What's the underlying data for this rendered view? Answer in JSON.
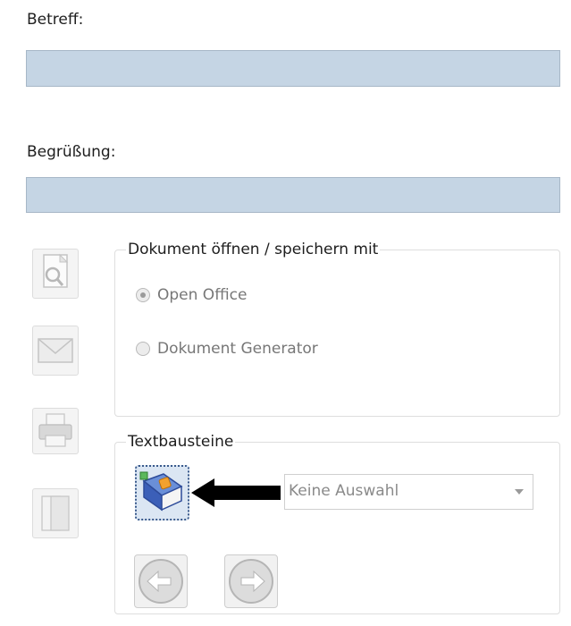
{
  "betreff": {
    "label": "Betreff:",
    "value": ""
  },
  "begruessung": {
    "label": "Begrüßung:",
    "value": ""
  },
  "sidebar": {
    "icons": [
      {
        "name": "preview-icon"
      },
      {
        "name": "email-icon"
      },
      {
        "name": "print-icon"
      },
      {
        "name": "document-icon"
      }
    ]
  },
  "document_group": {
    "legend": "Dokument öffnen / speichern mit",
    "options": [
      {
        "label": "Open Office",
        "selected": true
      },
      {
        "label": "Dokument Generator",
        "selected": false
      }
    ]
  },
  "textbausteine": {
    "legend": "Textbausteine",
    "book_icon": "textblock-book-icon",
    "arrow_icon": "pointer-arrow-icon",
    "combo_value": "Keine Auswahl",
    "nav": [
      "back-icon",
      "forward-icon"
    ]
  },
  "colors": {
    "field_bg": "#c5d5e4",
    "field_border": "#a7b7c7",
    "disabled_text": "#777777",
    "book_blue": "#4f73c9",
    "book_orange": "#f2a12e"
  }
}
